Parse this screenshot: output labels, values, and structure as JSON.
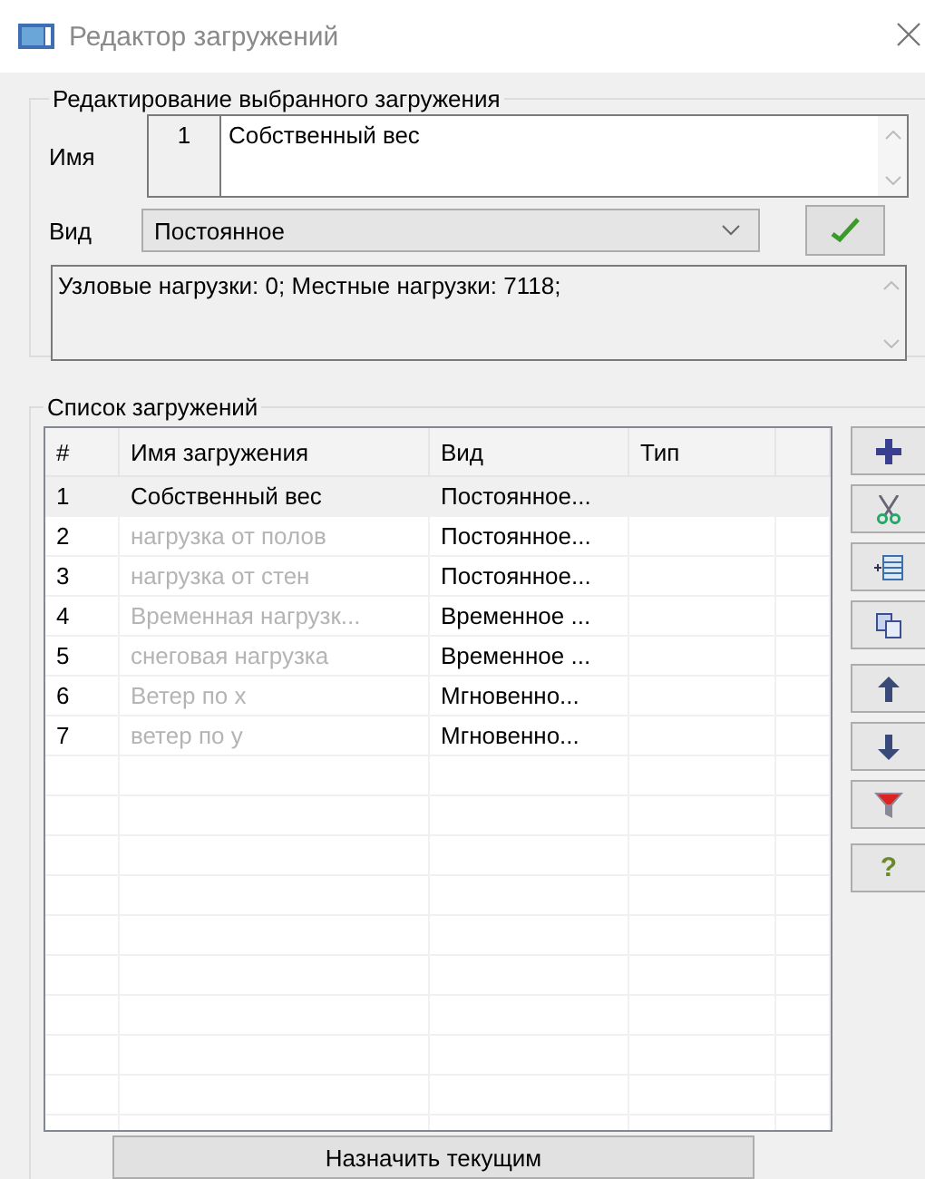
{
  "window": {
    "title": "Редактор загружений"
  },
  "edit_group": {
    "legend": "Редактирование выбранного загружения",
    "name_label": "Имя",
    "number": "1",
    "name_value": "Собственный вес",
    "type_label": "Вид",
    "type_value": "Постоянное",
    "info": "Узловые нагрузки:  0;  Местные нагрузки:  7118;"
  },
  "list_group": {
    "legend": "Список загружений",
    "columns": [
      "#",
      "Имя загружения",
      "Вид",
      "Тип"
    ],
    "rows": [
      {
        "number": "1",
        "name": "Собственный вес",
        "type": "Постоянное...",
        "selected": true,
        "muted": false
      },
      {
        "number": "2",
        "name": "нагрузка от полов",
        "type": "Постоянное...",
        "selected": false,
        "muted": true
      },
      {
        "number": "3",
        "name": "нагрузка от стен",
        "type": "Постоянное...",
        "selected": false,
        "muted": true
      },
      {
        "number": "4",
        "name": "Временная нагрузк...",
        "type": "Временное ...",
        "selected": false,
        "muted": true
      },
      {
        "number": "5",
        "name": "снеговая нагрузка",
        "type": "Временное ...",
        "selected": false,
        "muted": true
      },
      {
        "number": "6",
        "name": "Ветер по x",
        "type": "Мгновенно...",
        "selected": false,
        "muted": true
      },
      {
        "number": "7",
        "name": "ветер по y",
        "type": "Мгновенно...",
        "selected": false,
        "muted": true
      }
    ],
    "toolbar": [
      [
        {
          "kind": "add"
        },
        {
          "kind": "cut"
        },
        {
          "kind": "insert"
        },
        {
          "kind": "copy"
        }
      ],
      [
        {
          "kind": "up"
        },
        {
          "kind": "down"
        },
        {
          "kind": "filter"
        }
      ],
      [
        {
          "kind": "help",
          "label": "?"
        }
      ]
    ],
    "assign_button": "Назначить текущим"
  }
}
